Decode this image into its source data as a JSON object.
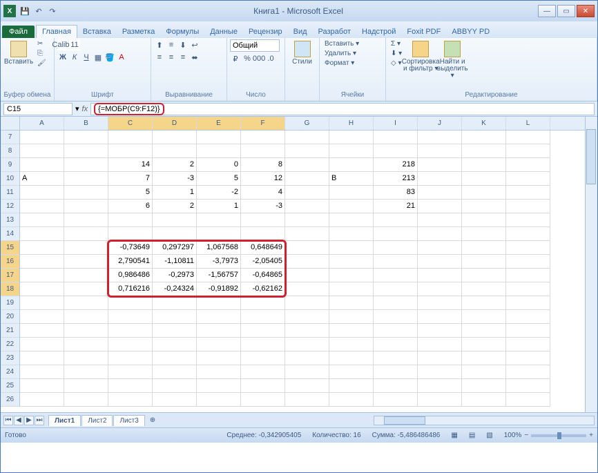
{
  "title": "Книга1 - Microsoft Excel",
  "qat": {
    "save": "💾",
    "undo": "↶",
    "redo": "↷"
  },
  "winbtns": {
    "min": "—",
    "max": "▭",
    "close": "✕"
  },
  "tabs": {
    "file": "Файл",
    "items": [
      "Главная",
      "Вставка",
      "Разметка",
      "Формулы",
      "Данные",
      "Рецензир",
      "Вид",
      "Разработ",
      "Надстрой",
      "Foxit PDF",
      "ABBYY PD"
    ]
  },
  "ribbon": {
    "clipboard": {
      "paste": "Вставить",
      "label": "Буфер обмена"
    },
    "font": {
      "name": "Calibri",
      "size": "11",
      "label": "Шрифт",
      "bold": "Ж",
      "italic": "К",
      "underline": "Ч"
    },
    "align": {
      "label": "Выравнивание"
    },
    "number": {
      "fmt": "Общий",
      "label": "Число"
    },
    "styles": {
      "btn": "Стили",
      "label": ""
    },
    "cells": {
      "insert": "Вставить ▾",
      "delete": "Удалить ▾",
      "format": "Формат ▾",
      "label": "Ячейки"
    },
    "editing": {
      "sort": "Сортировка\nи фильтр ▾",
      "find": "Найти и\nвыделить ▾",
      "label": "Редактирование",
      "sum": "Σ ▾",
      "fill": "⬇ ▾",
      "clear": "◇ ▾"
    }
  },
  "namebox": "C15",
  "formula": "{=МОБР(C9:F12)}",
  "fx": "fx",
  "columns": [
    "A",
    "B",
    "C",
    "D",
    "E",
    "F",
    "G",
    "H",
    "I",
    "J",
    "K",
    "L"
  ],
  "rows": [
    "7",
    "8",
    "9",
    "10",
    "11",
    "12",
    "13",
    "14",
    "15",
    "16",
    "17",
    "18",
    "19",
    "20",
    "21",
    "22",
    "23",
    "24",
    "25",
    "26"
  ],
  "matrixA": {
    "label": "A",
    "r1": {
      "c": "14",
      "d": "2",
      "e": "0",
      "f": "8"
    },
    "r2": {
      "c": "7",
      "d": "-3",
      "e": "5",
      "f": "12"
    },
    "r3": {
      "c": "5",
      "d": "1",
      "e": "-2",
      "f": "4"
    },
    "r4": {
      "c": "6",
      "d": "2",
      "e": "1",
      "f": "-3"
    }
  },
  "vectorB": {
    "label": "B",
    "v1": "218",
    "v2": "213",
    "v3": "83",
    "v4": "21"
  },
  "result": {
    "r1": {
      "c": "-0,73649",
      "d": "0,297297",
      "e": "1,067568",
      "f": "0,648649"
    },
    "r2": {
      "c": "2,790541",
      "d": "-1,10811",
      "e": "-3,7973",
      "f": "-2,05405"
    },
    "r3": {
      "c": "0,986486",
      "d": "-0,2973",
      "e": "-1,56757",
      "f": "-0,64865"
    },
    "r4": {
      "c": "0,716216",
      "d": "-0,24324",
      "e": "-0,91892",
      "f": "-0,62162"
    }
  },
  "sheets": {
    "s1": "Лист1",
    "s2": "Лист2",
    "s3": "Лист3"
  },
  "status": {
    "ready": "Готово",
    "avg_lbl": "Среднее:",
    "avg": "-0,342905405",
    "cnt_lbl": "Количество:",
    "cnt": "16",
    "sum_lbl": "Сумма:",
    "sum": "-5,486486486",
    "zoom": "100%",
    "minus": "−",
    "plus": "+"
  }
}
